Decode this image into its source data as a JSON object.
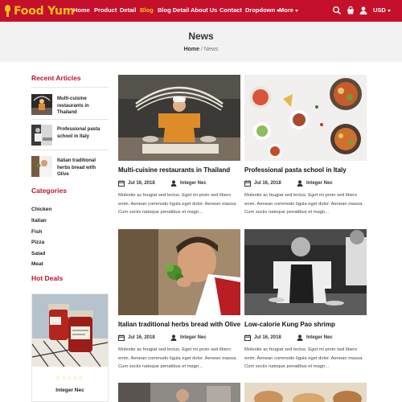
{
  "brand": {
    "name": "Food Yum"
  },
  "nav": {
    "items": [
      {
        "label": "Home"
      },
      {
        "label": "Product"
      },
      {
        "label": "Detail"
      },
      {
        "label": "Blog"
      },
      {
        "label": "Blog Detail"
      },
      {
        "label": "About Us"
      },
      {
        "label": "Contact"
      },
      {
        "label": "Dropdown"
      },
      {
        "label": "More"
      }
    ],
    "active": "Blog",
    "currency": "USD",
    "icons": [
      "search-icon",
      "cart-icon",
      "user-icon"
    ]
  },
  "page": {
    "title": "News",
    "breadcrumb": {
      "home": "Home",
      "separator": "/",
      "current": "News"
    }
  },
  "sidebar": {
    "recent_heading": "Recent Articles",
    "recent": [
      {
        "title": "Multi-cuisine restaurants in Thailand"
      },
      {
        "title": "Professional pasta school in Italy"
      },
      {
        "title": "Italian traditional herbs bread with Olive"
      }
    ],
    "categories_heading": "Categories",
    "categories": [
      "Chicken",
      "Italian",
      "Fish",
      "Pizza",
      "Salad",
      "Meat"
    ],
    "deals_heading": "Hot Deals",
    "deal": {
      "stars": "☆☆☆☆☆",
      "name": "Integer Nec"
    }
  },
  "posts": [
    {
      "title": "Multi-cuisine restaurants in Thailand",
      "date": "Jul 16, 2018",
      "author": "Integer Nec",
      "excerpt": "Molestie ac feugiat sed lectus. Eget mi proin sed libero enim. Aenean commodo ligula eget dolor. Aenean massa. Cum sociis natoque penatibus et magn..."
    },
    {
      "title": "Professional pasta school in Italy",
      "date": "Jul 16, 2018",
      "author": "Integer Nec",
      "excerpt": "Molestie ac feugiat sed lectus. Eget mi proin sed libero enim. Aenean commodo ligula eget dolor. Aenean massa. Cum sociis natoque penatibus et magn..."
    },
    {
      "title": "Italian traditional herbs bread with Olive",
      "date": "Jul 16, 2018",
      "author": "Integer Nec",
      "excerpt": "Molestie ac feugiat sed lectus. Eget mi proin sed libero enim. Aenean commodo ligula eget dolor. Aenean massa. Cum sociis natoque penatibus et magn..."
    },
    {
      "title": "Low-calorie Kung Pao shrimp",
      "date": "Jul 16, 2018",
      "author": "Integer Nec",
      "excerpt": "Molestie ac feugiat sed lectus. Eget mi proin sed libero enim. Aenean commodo ligula eget dolor. Aenean massa. Cum sociis natoque penatibus et magn..."
    }
  ],
  "colors": {
    "brand_red": "#c4102a",
    "accent_yellow": "#f7c21a",
    "header_bg": "#f2f2f2"
  }
}
